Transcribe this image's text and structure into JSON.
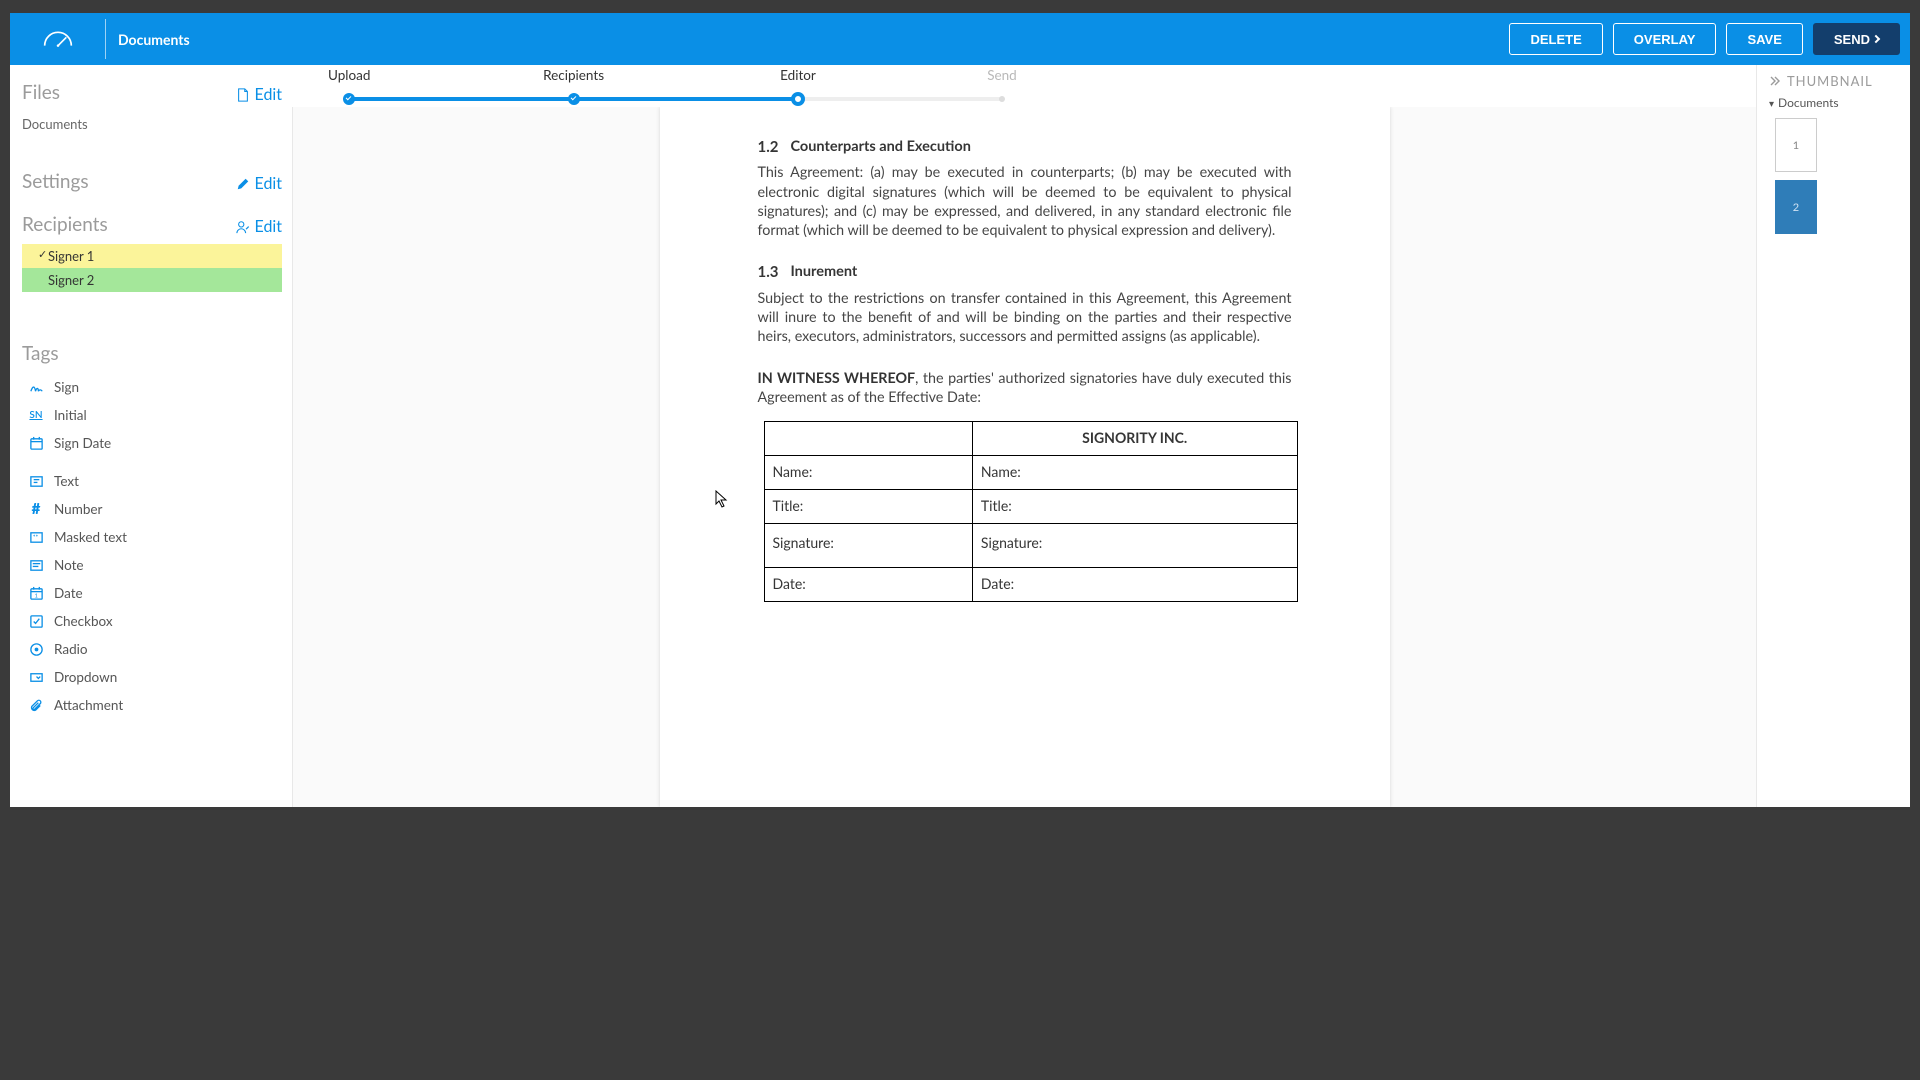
{
  "header": {
    "title": "Documents",
    "buttons": {
      "delete": "DELETE",
      "overlay": "OVERLAY",
      "save": "SAVE",
      "send": "SEND"
    }
  },
  "progress": {
    "steps": [
      "Upload",
      "Recipients",
      "Editor",
      "Send"
    ],
    "positions_pct": [
      4,
      37,
      70,
      100
    ],
    "completed_until": 2,
    "current": 2
  },
  "left": {
    "files": {
      "title": "Files",
      "edit": "Edit",
      "items": [
        "Documents"
      ]
    },
    "settings": {
      "title": "Settings",
      "edit": "Edit"
    },
    "recipients": {
      "title": "Recipients",
      "edit": "Edit",
      "items": [
        {
          "label": "Signer 1",
          "color": "#fbf49a",
          "selected": true
        },
        {
          "label": "Signer 2",
          "color": "#a4e79a",
          "selected": false
        }
      ]
    },
    "tags": {
      "title": "Tags",
      "groups": [
        [
          {
            "icon": "sign",
            "label": "Sign"
          },
          {
            "icon": "initial",
            "label": "Initial"
          },
          {
            "icon": "signdate",
            "label": "Sign Date"
          }
        ],
        [
          {
            "icon": "text",
            "label": "Text"
          },
          {
            "icon": "number",
            "label": "Number"
          },
          {
            "icon": "masked",
            "label": "Masked text"
          },
          {
            "icon": "note",
            "label": "Note"
          },
          {
            "icon": "date",
            "label": "Date"
          },
          {
            "icon": "checkbox",
            "label": "Checkbox"
          },
          {
            "icon": "radio",
            "label": "Radio"
          },
          {
            "icon": "dropdown",
            "label": "Dropdown"
          },
          {
            "icon": "attachment",
            "label": "Attachment"
          }
        ]
      ]
    }
  },
  "document": {
    "clauses": [
      {
        "num": "1.2",
        "title": "Counterparts and Execution",
        "body": "This Agreement: (a) may be executed in counterparts; (b) may be executed with electronic digital signatures (which will be deemed to be equivalent to physical signatures); and (c) may be expressed, and delivered, in any standard electronic file format (which will be deemed to be equivalent to physical expression and delivery)."
      },
      {
        "num": "1.3",
        "title": "Inurement",
        "body": "Subject to the restrictions on transfer contained in this Agreement, this Agreement will inure to the benefit of and will be binding on the parties and their respective heirs, executors, administrators, successors and permitted assigns (as applicable)."
      }
    ],
    "witness_lead": "IN WITNESS WHEREOF",
    "witness_tail": ", the parties' authorized signatories have duly executed this Agreement as of the Effective Date:",
    "table": {
      "head_blank": "",
      "head_company": "SIGNORITY INC.",
      "rows": [
        {
          "l": "Name:",
          "r": "Name:"
        },
        {
          "l": "Title:",
          "r": "Title:"
        },
        {
          "l": "Signature:",
          "r": "Signature:"
        },
        {
          "l": "Date:",
          "r": "Date:"
        }
      ]
    }
  },
  "right": {
    "title": "THUMBNAIL",
    "doc_label": "Documents",
    "pages": [
      {
        "n": "1",
        "active": false
      },
      {
        "n": "2",
        "active": true
      }
    ]
  }
}
